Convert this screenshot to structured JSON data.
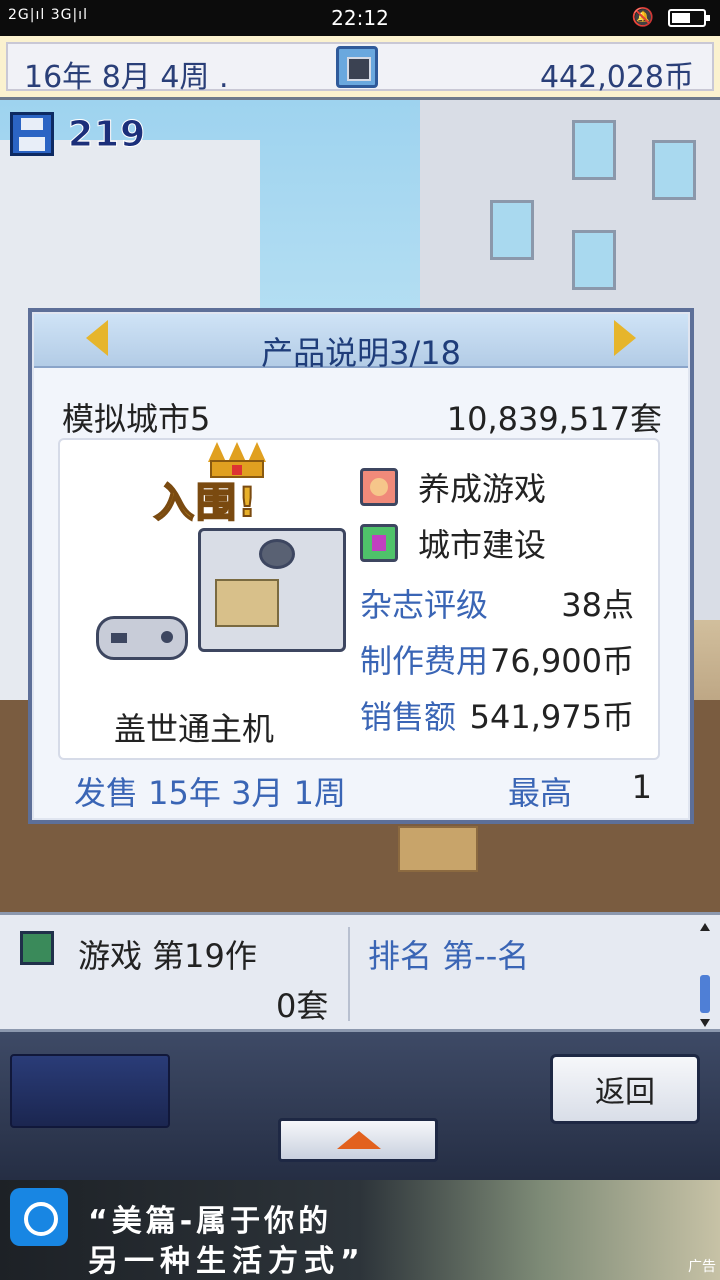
{
  "status_bar": {
    "signal": "2G|ıl 3G|ıl",
    "time": "22:12"
  },
  "top_bar": {
    "date": "16年 8月 4周 .",
    "coins": "442,028币"
  },
  "save_counter": "219",
  "product_dialog": {
    "title": "产品说明3/18",
    "product_name": "模拟城市5",
    "units_sold": "10,839,517套",
    "award": "入围!",
    "platform": "盖世通主机",
    "genres": [
      "养成游戏",
      "城市建设"
    ],
    "stats": [
      {
        "label": "杂志评级",
        "value": "38点"
      },
      {
        "label": "制作费用",
        "value": "76,900币"
      },
      {
        "label": "销售额",
        "value": "541,975币"
      }
    ],
    "release": "发售 15年 3月 1周",
    "peak_label": "最高",
    "peak_value": "1"
  },
  "info_bar": {
    "game_count": "游戏 第19作",
    "game_sold": "0套",
    "rank": "排名 第--名"
  },
  "controls": {
    "back_label": "返回"
  },
  "ad": {
    "line1": "“美篇-属于你的",
    "line2": "另一种生活方式”",
    "tag": "广告"
  },
  "colors": {
    "dialog_frame": "#5d6f98",
    "label_blue": "#3a65b5",
    "award_gold": "#e8b02a"
  }
}
